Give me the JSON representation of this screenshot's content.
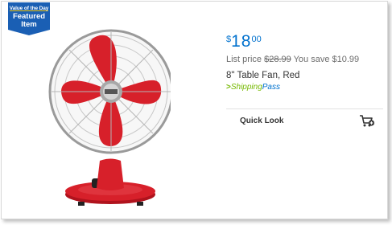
{
  "badge": {
    "line1": "Value of the Day",
    "line2": "Featured Item"
  },
  "product": {
    "image_icon": "red-table-fan",
    "price": {
      "currency": "$",
      "dollars": "18",
      "cents": "00"
    },
    "list_price_label": "List price",
    "list_price_value": "$28.99",
    "savings": "You save $10.99",
    "title": "8\" Table Fan, Red",
    "shipping": {
      "chevron": ">",
      "ship": "Shipping",
      "pass": "Pass"
    }
  },
  "actions": {
    "quick_look": "Quick Look",
    "cart_icon": "add-to-cart-icon"
  },
  "colors": {
    "price_blue": "#0071ce",
    "badge_blue": "#1a5fb4",
    "shipping_green": "#76b900",
    "fan_red": "#d7202a"
  }
}
